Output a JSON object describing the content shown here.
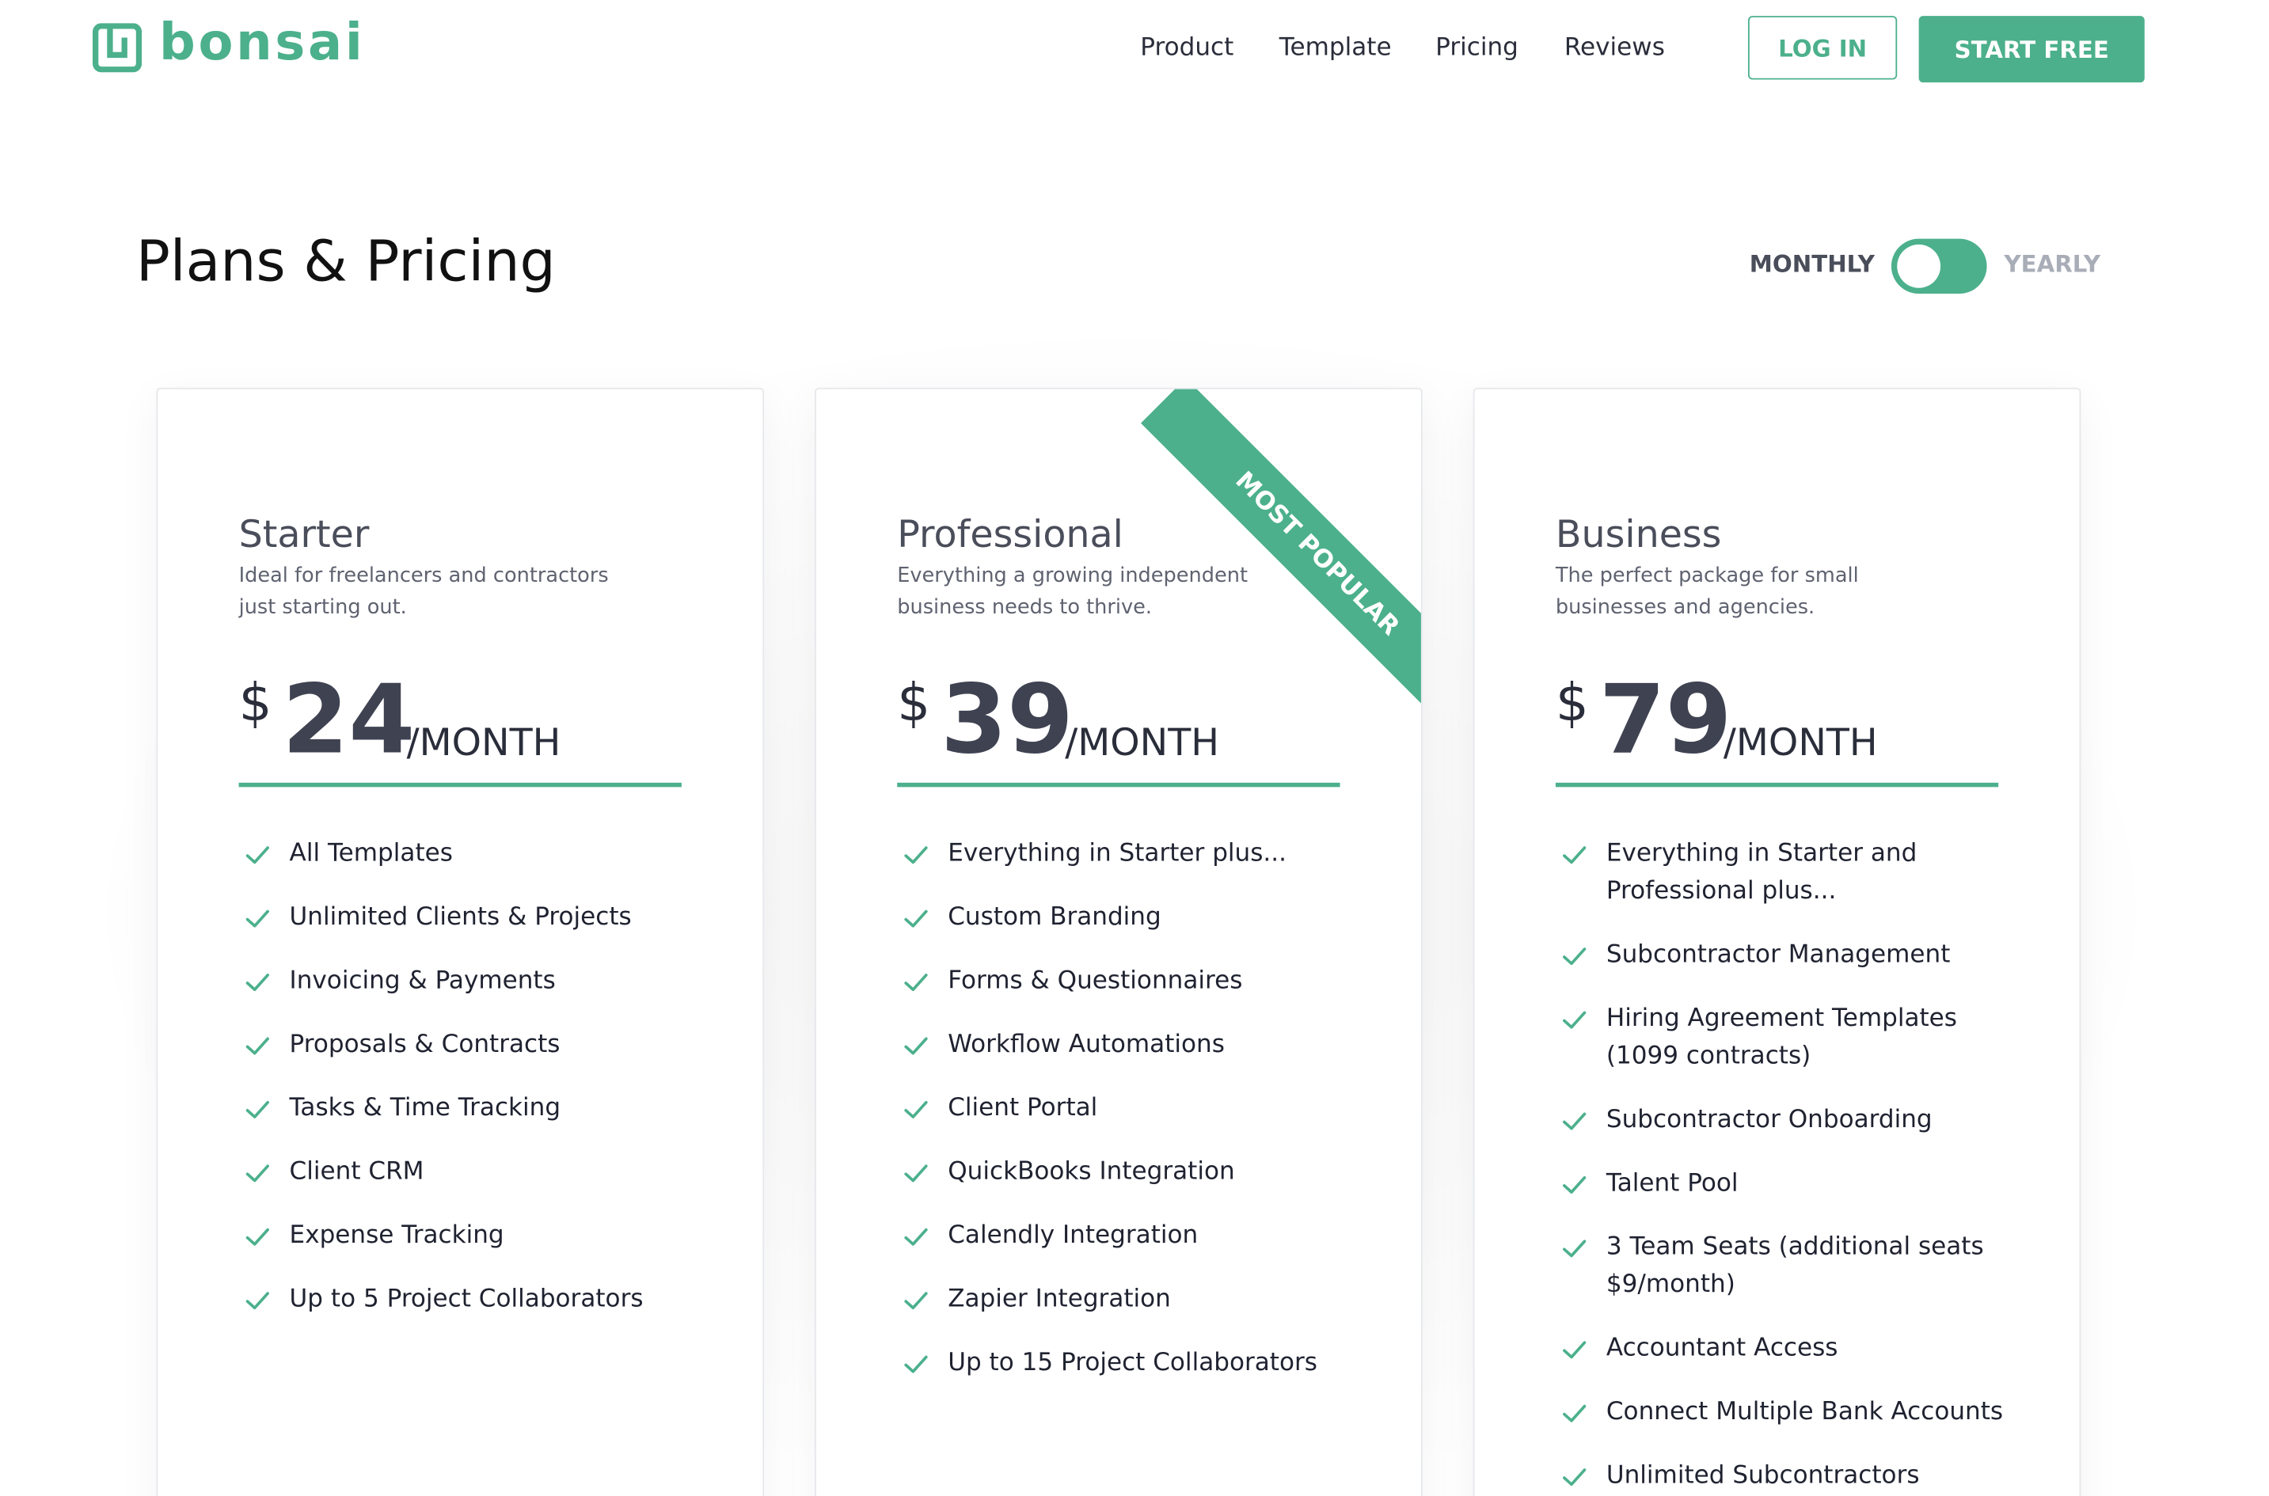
{
  "header": {
    "brand": "bonsai",
    "nav": [
      "Product",
      "Template",
      "Pricing",
      "Reviews"
    ],
    "login_label": "LOG IN",
    "start_label": "START FREE"
  },
  "pricing": {
    "title": "Plans & Pricing",
    "toggle": {
      "monthly": "MONTHLY",
      "yearly": "YEARLY",
      "selected": "MONTHLY"
    }
  },
  "plans": [
    {
      "name": "Starter",
      "description": "Ideal for freelancers and contractors just starting out.",
      "currency": "$",
      "price": "24",
      "period": "/MONTH",
      "features": [
        "All Templates",
        "Unlimited Clients & Projects",
        "Invoicing & Payments",
        "Proposals & Contracts",
        "Tasks & Time Tracking",
        "Client CRM",
        "Expense Tracking",
        "Up to 5 Project Collaborators"
      ]
    },
    {
      "name": "Professional",
      "description": "Everything a growing independent business needs to thrive.",
      "currency": "$",
      "price": "39",
      "period": "/MONTH",
      "ribbon": "MOST POPULAR",
      "features": [
        "Everything in Starter plus...",
        "Custom Branding",
        "Forms & Questionnaires",
        "Workflow Automations",
        "Client Portal",
        "QuickBooks Integration",
        "Calendly Integration",
        "Zapier Integration",
        "Up to 15 Project Collaborators"
      ]
    },
    {
      "name": "Business",
      "description": "The perfect package for small businesses and agencies.",
      "currency": "$",
      "price": "79",
      "period": "/MONTH",
      "features": [
        "Everything in Starter and Professional plus...",
        "Subcontractor Management",
        "Hiring Agreement Templates (1099 contracts)",
        "Subcontractor Onboarding",
        "Talent Pool",
        "3 Team Seats (additional seats $9/month)",
        "Accountant Access",
        "Connect Multiple Bank Accounts",
        "Unlimited Subcontractors"
      ]
    }
  ],
  "colors": {
    "accent": "#4cb08c",
    "text": "#2a2d3a",
    "muted": "#a8adb7"
  },
  "icons": {
    "logo": "bonsai-logo-icon",
    "check": "check-icon"
  }
}
